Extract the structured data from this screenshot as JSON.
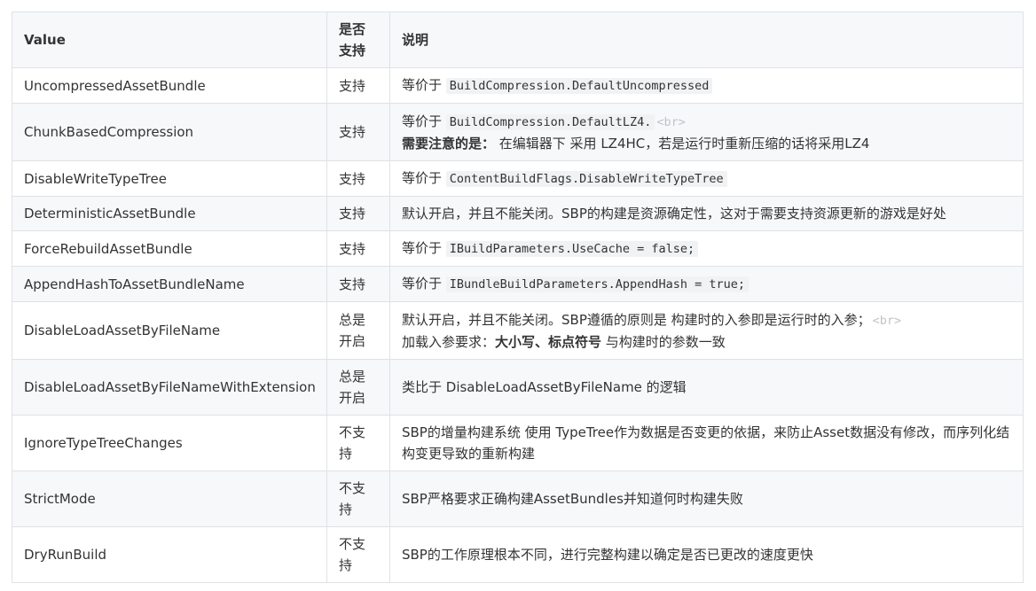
{
  "table": {
    "headers": {
      "value": "Value",
      "support": "是否支持",
      "desc": "说明"
    },
    "rows": [
      {
        "value": "UncompressedAssetBundle",
        "support": "支持",
        "desc_prefix": "等价于 ",
        "desc_code": "BuildCompression.DefaultUncompressed"
      },
      {
        "value": "ChunkBasedCompression",
        "support": "支持",
        "desc_prefix": "等价于 ",
        "desc_code": "BuildCompression.DefaultLZ4.",
        "desc_br": "<br>",
        "desc_bold": "需要注意的是：",
        "desc_line2": " 在编辑器下 采用 LZ4HC，若是运行时重新压缩的话将采用LZ4"
      },
      {
        "value": "DisableWriteTypeTree",
        "support": "支持",
        "desc_prefix": "等价于 ",
        "desc_code": "ContentBuildFlags.DisableWriteTypeTree"
      },
      {
        "value": "DeterministicAssetBundle",
        "support": "支持",
        "desc": "默认开启，并且不能关闭。SBP的构建是资源确定性，这对于需要支持资源更新的游戏是好处"
      },
      {
        "value": "ForceRebuildAssetBundle",
        "support": "支持",
        "desc_prefix": "等价于 ",
        "desc_code": "IBuildParameters.UseCache = false;"
      },
      {
        "value": "AppendHashToAssetBundleName",
        "support": "支持",
        "desc_prefix": "等价于 ",
        "desc_code": "IBundleBuildParameters.AppendHash = true;"
      },
      {
        "value": "DisableLoadAssetByFileName",
        "support": "总是开启",
        "desc_line1": "默认开启，并且不能关闭。SBP遵循的原则是 构建时的入参即是运行时的入参；",
        "desc_br": "<br>",
        "desc_line2_prefix": "加载入参要求：",
        "desc_bold": "大小写、标点符号",
        "desc_line2_suffix": " 与构建时的参数一致"
      },
      {
        "value": "DisableLoadAssetByFileNameWithExtension",
        "support": "总是开启",
        "desc": "类比于 DisableLoadAssetByFileName 的逻辑"
      },
      {
        "value": "IgnoreTypeTreeChanges",
        "support": "不支持",
        "desc": "SBP的增量构建系统 使用 TypeTree作为数据是否变更的依据，来防止Asset数据没有修改，而序列化结构变更导致的重新构建"
      },
      {
        "value": "StrictMode",
        "support": "不支持",
        "desc": "SBP严格要求正确构建AssetBundles并知道何时构建失败"
      },
      {
        "value": "DryRunBuild",
        "support": "不支持",
        "desc": "SBP的工作原理根本不同，进行完整构建以确定是否已更改的速度更快"
      }
    ]
  }
}
